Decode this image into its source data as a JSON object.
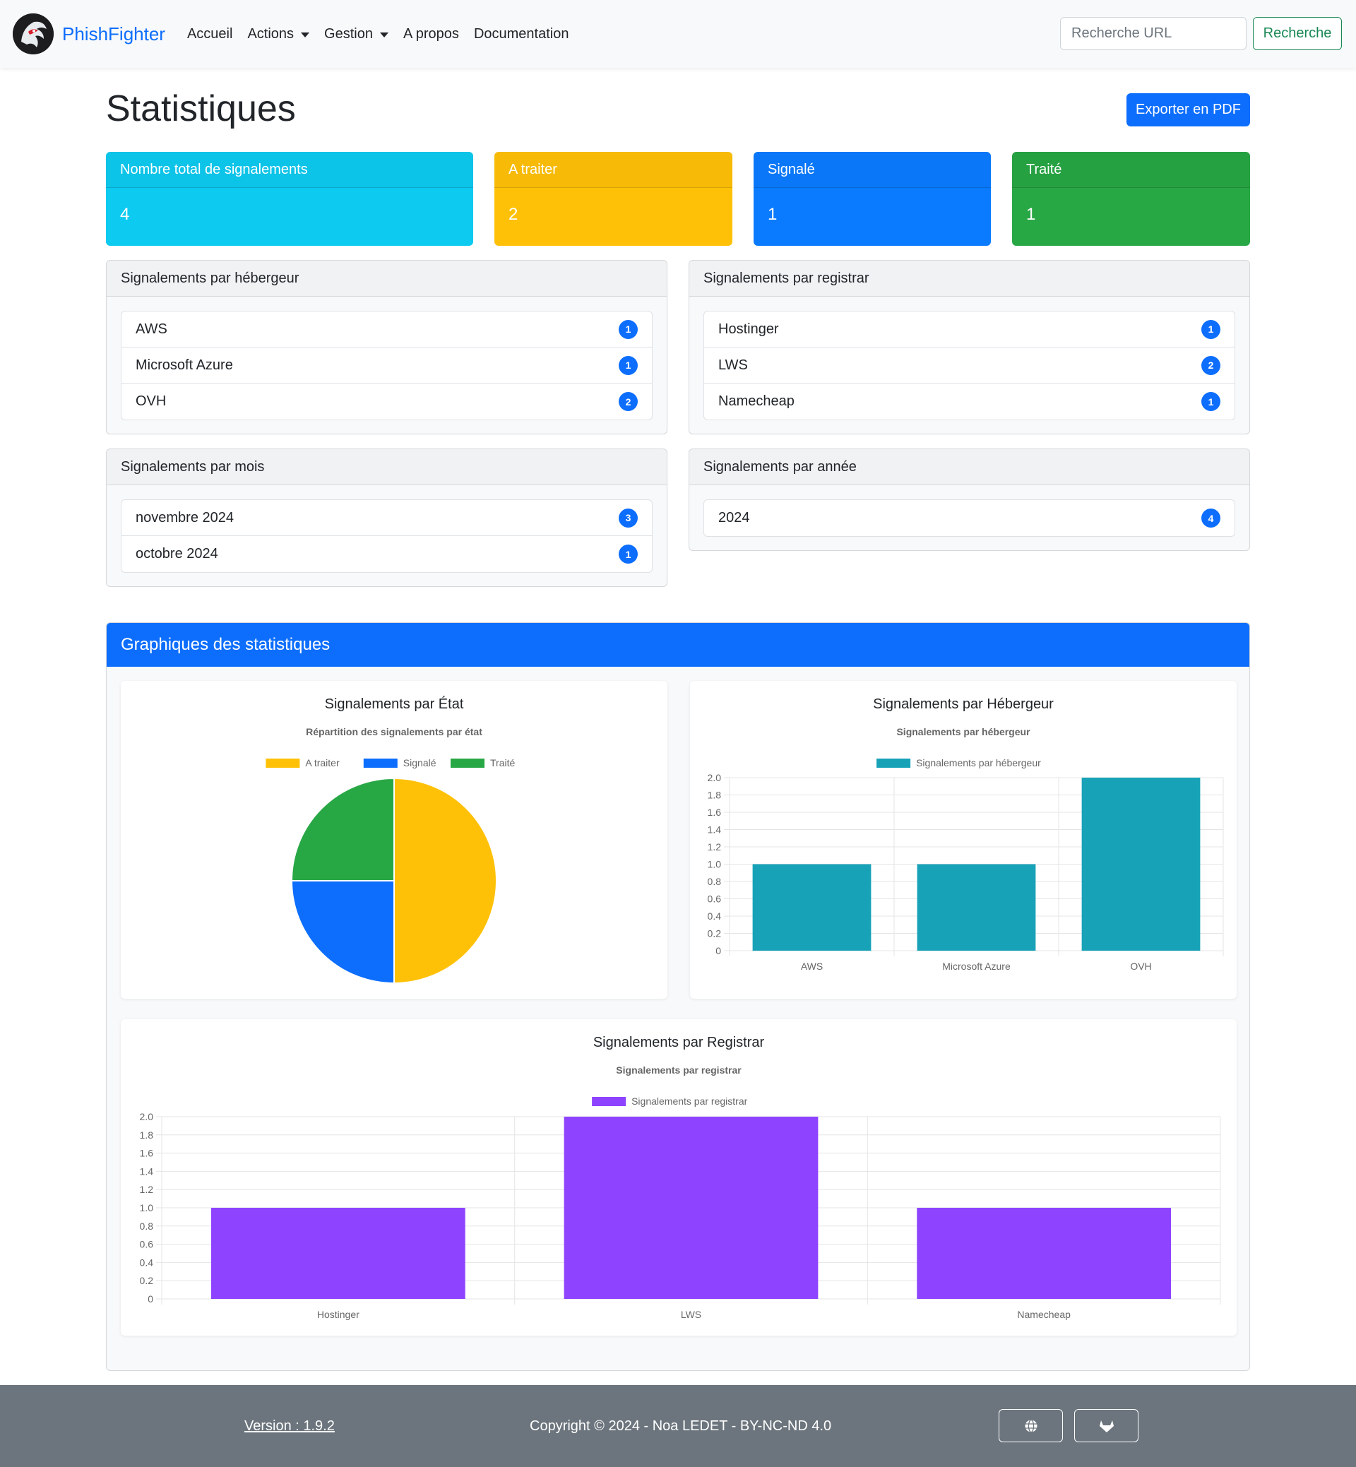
{
  "navbar": {
    "brand": "PhishFighter",
    "links": [
      {
        "label": "Accueil",
        "dropdown": false
      },
      {
        "label": "Actions",
        "dropdown": true
      },
      {
        "label": "Gestion",
        "dropdown": true
      },
      {
        "label": "A propos",
        "dropdown": false
      },
      {
        "label": "Documentation",
        "dropdown": false
      }
    ],
    "search_placeholder": "Recherche URL",
    "search_button": "Recherche"
  },
  "page": {
    "title": "Statistiques",
    "export_button": "Exporter en PDF"
  },
  "stats": [
    {
      "label": "Nombre total de signalements",
      "value": "4",
      "color": "#0dcaf0"
    },
    {
      "label": "A traiter",
      "value": "2",
      "color": "#ffc107"
    },
    {
      "label": "Signalé",
      "value": "1",
      "color": "#0d6efd"
    },
    {
      "label": "Traité",
      "value": "1",
      "color": "#28a745"
    }
  ],
  "cards": {
    "hebergeur": {
      "title": "Signalements par hébergeur",
      "items": [
        {
          "name": "AWS",
          "count": "1"
        },
        {
          "name": "Microsoft Azure",
          "count": "1"
        },
        {
          "name": "OVH",
          "count": "2"
        }
      ]
    },
    "registrar": {
      "title": "Signalements par registrar",
      "items": [
        {
          "name": "Hostinger",
          "count": "1"
        },
        {
          "name": "LWS",
          "count": "2"
        },
        {
          "name": "Namecheap",
          "count": "1"
        }
      ]
    },
    "mois": {
      "title": "Signalements par mois",
      "items": [
        {
          "name": "novembre 2024",
          "count": "3"
        },
        {
          "name": "octobre 2024",
          "count": "1"
        }
      ]
    },
    "annee": {
      "title": "Signalements par année",
      "items": [
        {
          "name": "2024",
          "count": "4"
        }
      ]
    }
  },
  "charts_section": {
    "title": "Graphiques des statistiques"
  },
  "chart_data": [
    {
      "type": "pie",
      "heading": "Signalements par État",
      "title": "Répartition des signalements par état",
      "categories": [
        "A traiter",
        "Signalé",
        "Traité"
      ],
      "values": [
        2,
        1,
        1
      ],
      "colors": [
        "#ffc107",
        "#0d6efd",
        "#28a745"
      ],
      "legend": "top"
    },
    {
      "type": "bar",
      "heading": "Signalements par Hébergeur",
      "title": "Signalements par hébergeur",
      "categories": [
        "AWS",
        "Microsoft Azure",
        "OVH"
      ],
      "series": [
        {
          "name": "Signalements par hébergeur",
          "values": [
            1,
            1,
            2
          ],
          "color": "#17a2b8"
        }
      ],
      "ylim": [
        0,
        2
      ],
      "yticks": [
        "0",
        "0.2",
        "0.4",
        "0.6",
        "0.8",
        "1.0",
        "1.2",
        "1.4",
        "1.6",
        "1.8",
        "2.0"
      ],
      "grid": true,
      "legend": "top"
    },
    {
      "type": "bar",
      "heading": "Signalements par Registrar",
      "title": "Signalements par registrar",
      "categories": [
        "Hostinger",
        "LWS",
        "Namecheap"
      ],
      "series": [
        {
          "name": "Signalements par registrar",
          "values": [
            1,
            2,
            1
          ],
          "color": "#8e44ff"
        }
      ],
      "ylim": [
        0,
        2
      ],
      "yticks": [
        "0",
        "0.2",
        "0.4",
        "0.6",
        "0.8",
        "1.0",
        "1.2",
        "1.4",
        "1.6",
        "1.8",
        "2.0"
      ],
      "grid": true,
      "legend": "top"
    }
  ],
  "footer": {
    "version": "Version : 1.9.2",
    "copyright": "Copyright © 2024 - Noa LEDET - BY-NC-ND 4.0",
    "buttons": [
      {
        "icon": "globe-icon"
      },
      {
        "icon": "gitlab-icon"
      }
    ]
  }
}
